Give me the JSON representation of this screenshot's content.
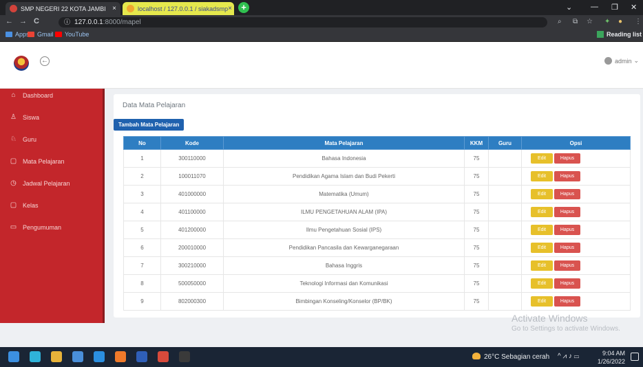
{
  "browser": {
    "tabs": [
      {
        "title": "SMP NEGERI 22 KOTA JAMBI",
        "close": "×"
      },
      {
        "title": "localhost / 127.0.0.1 / siakadsmp",
        "close": "×"
      }
    ],
    "new_tab": "+",
    "window_controls": {
      "chevron": "⌄",
      "minimize": "—",
      "maximize": "❐",
      "close": "✕"
    },
    "nav": {
      "back": "←",
      "forward": "→",
      "reload": "C"
    },
    "url_info_icon": "ⓘ",
    "url_host": "127.0.0.1",
    "url_path": ":8000/mapel",
    "toolbar_icons": [
      "zoom-icon",
      "share-icon",
      "star-icon",
      "extension-icon",
      "profile-icon",
      "menu-icon"
    ],
    "bookmarks": [
      {
        "label": "Apps",
        "color": "#f4b400"
      },
      {
        "label": "Gmail",
        "color": "#ea4335"
      },
      {
        "label": "YouTube",
        "color": "#ff0000"
      }
    ],
    "reading_list": "Reading list"
  },
  "header": {
    "menu_toggle": "←",
    "user": "admin",
    "user_caret": "⌄"
  },
  "sidebar": {
    "items": [
      {
        "label": "Dashboard",
        "icon": "⌂"
      },
      {
        "label": "Siswa",
        "icon": "♙"
      },
      {
        "label": "Guru",
        "icon": "♘"
      },
      {
        "label": "Mata Pelajaran",
        "icon": "▢"
      },
      {
        "label": "Jadwal Pelajaran",
        "icon": "◷"
      },
      {
        "label": "Kelas",
        "icon": "▢"
      },
      {
        "label": "Pengumuman",
        "icon": "▭"
      }
    ]
  },
  "main": {
    "title": "Data Mata Pelajaran",
    "add_button": "Tambah Mata Pelajaran",
    "table": {
      "headers": [
        "No",
        "Kode",
        "Mata Pelajaran",
        "KKM",
        "Guru",
        "Opsi"
      ],
      "rows": [
        {
          "no": "1",
          "kode": "300110000",
          "mapel": "Bahasa Indonesia",
          "kkm": "75",
          "guru": ""
        },
        {
          "no": "2",
          "kode": "100011070",
          "mapel": "Pendidikan Agama Islam dan Budi Pekerti",
          "kkm": "75",
          "guru": ""
        },
        {
          "no": "3",
          "kode": "401000000",
          "mapel": "Matematika (Umum)",
          "kkm": "75",
          "guru": ""
        },
        {
          "no": "4",
          "kode": "401100000",
          "mapel": "ILMU PENGETAHUAN ALAM (IPA)",
          "kkm": "75",
          "guru": ""
        },
        {
          "no": "5",
          "kode": "401200000",
          "mapel": "Ilmu Pengetahuan Sosial (IPS)",
          "kkm": "75",
          "guru": ""
        },
        {
          "no": "6",
          "kode": "200010000",
          "mapel": "Pendidikan Pancasila dan Kewarganegaraan",
          "kkm": "75",
          "guru": ""
        },
        {
          "no": "7",
          "kode": "300210000",
          "mapel": "Bahasa Inggris",
          "kkm": "75",
          "guru": ""
        },
        {
          "no": "8",
          "kode": "500050000",
          "mapel": "Teknologi Informasi dan Komunikasi",
          "kkm": "75",
          "guru": ""
        },
        {
          "no": "9",
          "kode": "802000300",
          "mapel": "Bimbingan Konseling/Konselor (BP/BK)",
          "kkm": "75",
          "guru": ""
        }
      ],
      "edit_label": "Edit",
      "delete_label": "Hapus"
    }
  },
  "watermark": {
    "line1": "Activate Windows",
    "line2": "Go to Settings to activate Windows."
  },
  "taskbar": {
    "apps": [
      {
        "name": "windows-start-icon",
        "color": "#3c8fe0"
      },
      {
        "name": "edge-icon",
        "color": "#2fb3d9"
      },
      {
        "name": "file-explorer-icon",
        "color": "#e8b33a"
      },
      {
        "name": "store-icon",
        "color": "#4a8fd9"
      },
      {
        "name": "vscode-icon",
        "color": "#2b8fe0"
      },
      {
        "name": "xampp-icon",
        "color": "#f07a2a"
      },
      {
        "name": "word-icon",
        "color": "#2f5fb8"
      },
      {
        "name": "chrome-icon",
        "color": "#d84a3b"
      },
      {
        "name": "terminal-icon",
        "color": "#3a3a3a"
      }
    ],
    "weather": "26°C  Sebagian cerah",
    "tray_icons": "^  ⩘  ♪  ▭",
    "time": "9:04 AM",
    "date": "1/26/2022"
  }
}
